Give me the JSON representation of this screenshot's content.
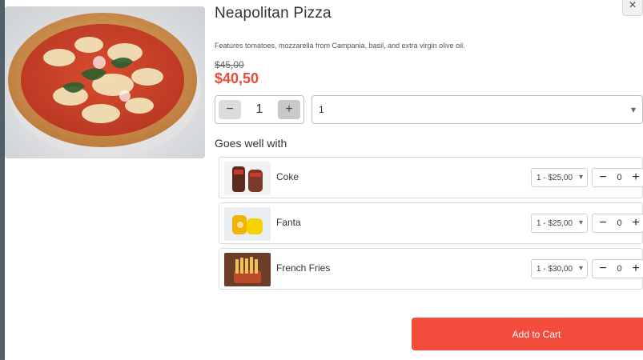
{
  "modal": {
    "close_label": "×"
  },
  "product": {
    "title": "Neapolitan Pizza",
    "description": "Features tomatoes, mozzarella from Campania, basil, and extra virgin olive oil.",
    "old_price": "$45,00",
    "price": "$40,50",
    "quantity": "1",
    "select_value": "1",
    "colors": {
      "price": "#e74c3c",
      "accent": "#f24c3d"
    },
    "icons": {
      "minus": "minus-icon",
      "plus": "plus-icon",
      "chevron": "chevron-down-icon"
    }
  },
  "addons": {
    "title": "Goes well with",
    "items": [
      {
        "name": "Coke",
        "option": "1 - $25,00",
        "qty": "0"
      },
      {
        "name": "Fanta",
        "option": "1 - $25,00",
        "qty": "0"
      },
      {
        "name": "French Fries",
        "option": "1 - $30,00",
        "qty": "0"
      }
    ]
  },
  "actions": {
    "add_to_cart": "Add to Cart"
  }
}
